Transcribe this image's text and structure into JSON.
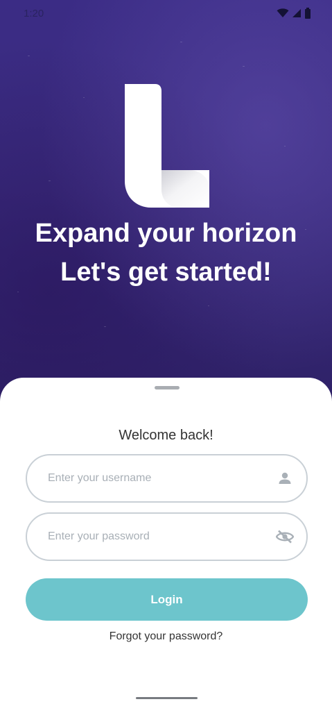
{
  "status_bar": {
    "time": "1:20",
    "icons": [
      "wifi-icon",
      "signal-icon",
      "battery-icon"
    ]
  },
  "hero": {
    "logo": "L",
    "headline_line1": "Expand your horizon",
    "headline_line2": "Let's get started!"
  },
  "sheet": {
    "welcome": "Welcome back!",
    "username": {
      "placeholder": "Enter your username",
      "value": "",
      "icon": "person-icon"
    },
    "password": {
      "placeholder": "Enter your password",
      "value": "",
      "icon": "visibility-off-icon"
    },
    "login_label": "Login",
    "forgot_label": "Forgot your password?"
  },
  "colors": {
    "hero_bg": "#3a2b7e",
    "accent": "#6dc5cc",
    "field_border": "#c9d0d6",
    "text": "#333333"
  }
}
